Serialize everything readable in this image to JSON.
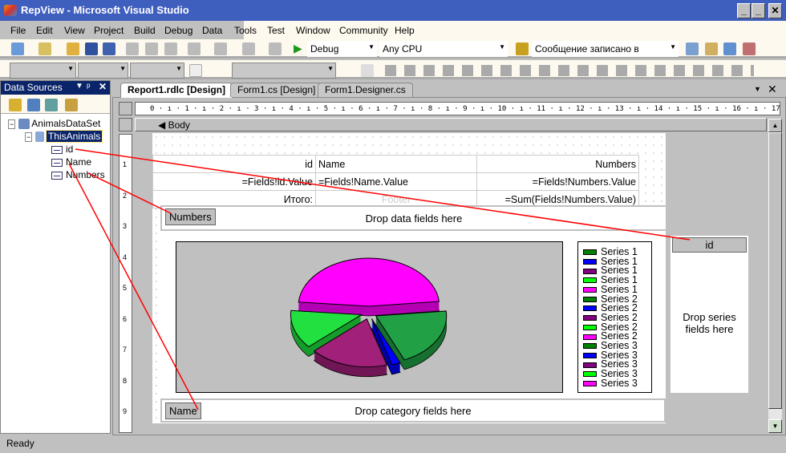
{
  "window": {
    "title": "RepView - Microsoft Visual Studio",
    "minimize": "_",
    "maximize": "□",
    "close": "✕"
  },
  "menu": [
    "File",
    "Edit",
    "View",
    "Project",
    "Build",
    "Debug",
    "Data",
    "Tools",
    "Test",
    "Window",
    "Community",
    "Help"
  ],
  "toolbar": {
    "config": "Debug",
    "platform": "Any CPU",
    "find": "Сообщение записано в"
  },
  "data_sources": {
    "title": "Data Sources",
    "dataset": "AnimalsDataSet",
    "table": "ThisAnimals",
    "fields": [
      "id",
      "Name",
      "Numbers"
    ]
  },
  "tabs": [
    {
      "label": "Report1.rdlc [Design]",
      "active": true
    },
    {
      "label": "Form1.cs [Design]"
    },
    {
      "label": "Form1.Designer.cs"
    }
  ],
  "ruler": "0 · ı · 1 · ı · 2 · ı · 3 · ı · 4 · ı · 5 · ı · 6 · ı · 7 · ı · 8 · ı · 9 · ı · 10 · ı · 11 · ı · 12 · ı · 13 · ı · 14 · ı · 15 · ı · 16 · ı · 17 · ı · 18 · ı · 19 · ı · 20 ·",
  "vruler": [
    "1",
    "2",
    "3",
    "4",
    "5",
    "6",
    "7",
    "8",
    "9"
  ],
  "body_label": "Body",
  "table": {
    "header": [
      "id",
      "Name",
      "Numbers"
    ],
    "detail": [
      "=Fields!id.Value",
      "=Fields!Name.Value",
      "=Fields!Numbers.Value"
    ],
    "footer": [
      "Итого:",
      "Footer",
      "=Sum(Fields!Numbers.Value)"
    ]
  },
  "chart": {
    "data_field": "Numbers",
    "data_drop": "Drop data fields here",
    "series_field": "id",
    "series_drop": "Drop series fields here",
    "category_field": "Name",
    "category_drop": "Drop category fields here",
    "legend": [
      {
        "label": "Series 1",
        "color": "#008000"
      },
      {
        "label": "Series 1",
        "color": "#0000ff"
      },
      {
        "label": "Series 1",
        "color": "#800080"
      },
      {
        "label": "Series 1",
        "color": "#00ff00"
      },
      {
        "label": "Series 1",
        "color": "#ff00ff"
      },
      {
        "label": "Series 2",
        "color": "#008000"
      },
      {
        "label": "Series 2",
        "color": "#0000ff"
      },
      {
        "label": "Series 2",
        "color": "#800080"
      },
      {
        "label": "Series 2",
        "color": "#00ff00"
      },
      {
        "label": "Series 2",
        "color": "#ff00ff"
      },
      {
        "label": "Series 3",
        "color": "#008000"
      },
      {
        "label": "Series 3",
        "color": "#0000ff"
      },
      {
        "label": "Series 3",
        "color": "#800080"
      },
      {
        "label": "Series 3",
        "color": "#00ff00"
      },
      {
        "label": "Series 3",
        "color": "#ff00ff"
      }
    ]
  },
  "chart_data": {
    "type": "pie",
    "values": [
      47,
      20,
      2,
      18,
      13
    ],
    "colors": [
      "#ff00ff",
      "#22a045",
      "#0000ff",
      "#a0207a",
      "#22e040"
    ]
  },
  "status": "Ready"
}
